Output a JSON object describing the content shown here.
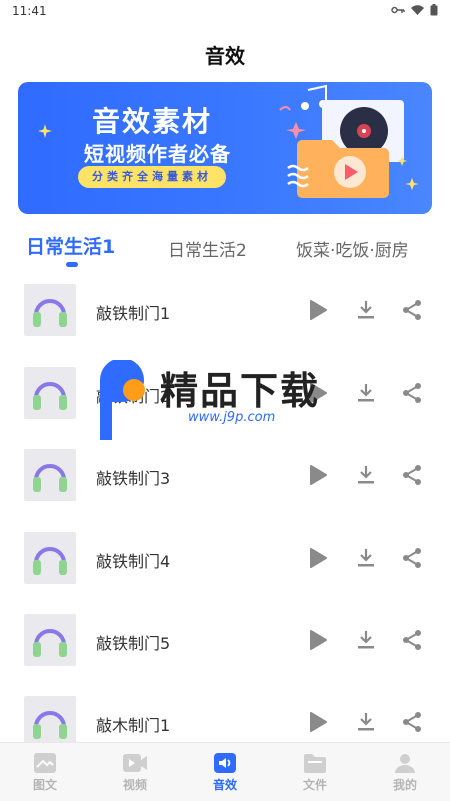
{
  "status_bar": {
    "time": "11:41"
  },
  "header": {
    "title": "音效"
  },
  "banner": {
    "title": "音效素材",
    "subtitle": "短视频作者必备",
    "tagline": "分类齐全海量素材"
  },
  "tabs": [
    {
      "label": "日常生活1",
      "active": true
    },
    {
      "label": "日常生活2",
      "active": false
    },
    {
      "label": "饭菜·吃饭·厨房",
      "active": false
    }
  ],
  "sounds": [
    {
      "title": "敲铁制门1"
    },
    {
      "title": "敲铁制门2"
    },
    {
      "title": "敲铁制门3"
    },
    {
      "title": "敲铁制门4"
    },
    {
      "title": "敲铁制门5"
    },
    {
      "title": "敲木制门1"
    }
  ],
  "watermark": {
    "text": "精品下载",
    "url": "www.j9p.com"
  },
  "bottom_nav": [
    {
      "label": "图文",
      "icon": "image-text-icon",
      "active": false
    },
    {
      "label": "视频",
      "icon": "video-icon",
      "active": false
    },
    {
      "label": "音效",
      "icon": "sound-icon",
      "active": true
    },
    {
      "label": "文件",
      "icon": "folder-icon",
      "active": false
    },
    {
      "label": "我的",
      "icon": "person-icon",
      "active": false
    }
  ],
  "colors": {
    "accent": "#2f6bff",
    "icon_gray": "#8a8a8a",
    "headphone_green": "#8fd58f",
    "headphone_purple": "#8a78e8"
  }
}
